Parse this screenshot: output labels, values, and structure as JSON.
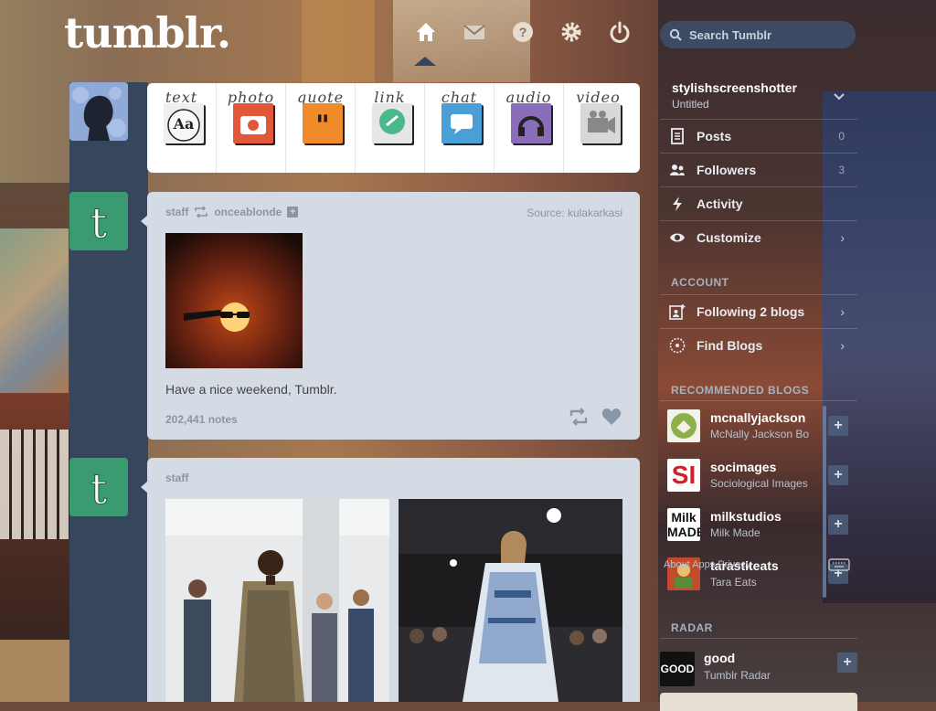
{
  "header": {
    "logo": "tumblr.",
    "search_placeholder": "Search Tumblr",
    "nav": [
      "home-icon",
      "envelope-icon",
      "help-icon",
      "gear-icon",
      "power-icon"
    ]
  },
  "post_types": [
    {
      "label": "text",
      "color": "#e9e9e9"
    },
    {
      "label": "photo",
      "color": "#e0573a"
    },
    {
      "label": "quote",
      "color": "#f08b2c"
    },
    {
      "label": "link",
      "color": "#4ab88a"
    },
    {
      "label": "chat",
      "color": "#4aa0d6"
    },
    {
      "label": "audio",
      "color": "#8a6db8"
    },
    {
      "label": "video",
      "color": "#9a9a9a"
    }
  ],
  "posts": [
    {
      "author": "staff",
      "reblogged_from": "onceablonde",
      "source_label": "Source:",
      "source": "kulakarkasi",
      "caption": "Have a nice weekend, Tumblr.",
      "notes": "202,441 notes"
    },
    {
      "author": "staff"
    }
  ],
  "sidebar": {
    "blog_name": "stylishscreenshotter",
    "blog_title": "Untitled",
    "menu": [
      {
        "label": "Posts",
        "count": "0"
      },
      {
        "label": "Followers",
        "count": "3"
      },
      {
        "label": "Activity"
      },
      {
        "label": "Customize"
      }
    ],
    "account_header": "ACCOUNT",
    "account": [
      {
        "label": "Following 2 blogs"
      },
      {
        "label": "Find Blogs"
      }
    ],
    "recommended_header": "RECOMMENDED BLOGS",
    "recommended": [
      {
        "name": "mcnallyjackson",
        "sub": "McNally Jackson Bo",
        "thumb_text": ""
      },
      {
        "name": "socimages",
        "sub": "Sociological Images",
        "thumb_text": "SI"
      },
      {
        "name": "milkstudios",
        "sub": "Milk Made",
        "thumb_text": "Milk MADE"
      },
      {
        "name": "tarastiteats",
        "sub": "Tara Eats",
        "thumb_text": ""
      }
    ],
    "overlay_text": "About  Apps  Privacy",
    "radar_header": "RADAR",
    "radar": {
      "name": "good",
      "sub": "Tumblr Radar",
      "thumb_text": "GOOD"
    },
    "follow_symbol": "+"
  }
}
